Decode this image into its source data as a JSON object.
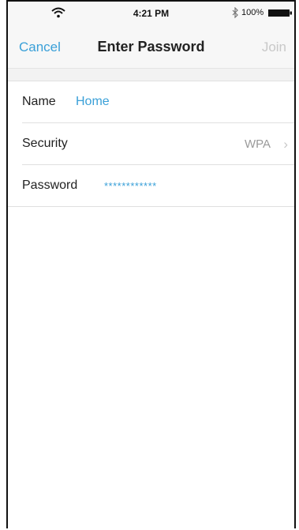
{
  "status_bar": {
    "time": "4:21 PM",
    "battery": "100%",
    "icons": [
      "wifi-icon",
      "bluetooth-icon",
      "battery-icon"
    ]
  },
  "nav": {
    "cancel_label": "Cancel",
    "title": "Enter Password",
    "join_label": "Join"
  },
  "form": {
    "name_label": "Name",
    "name_value": "Home",
    "security_label": "Security",
    "security_value": "WPA",
    "security_icon": "chevron-right-icon",
    "password_label": "Password",
    "password_value": "************"
  },
  "colors": {
    "accent": "#3aa0d8",
    "disabled": "#c8c8c8",
    "secondary_text": "#9a9a9a"
  }
}
